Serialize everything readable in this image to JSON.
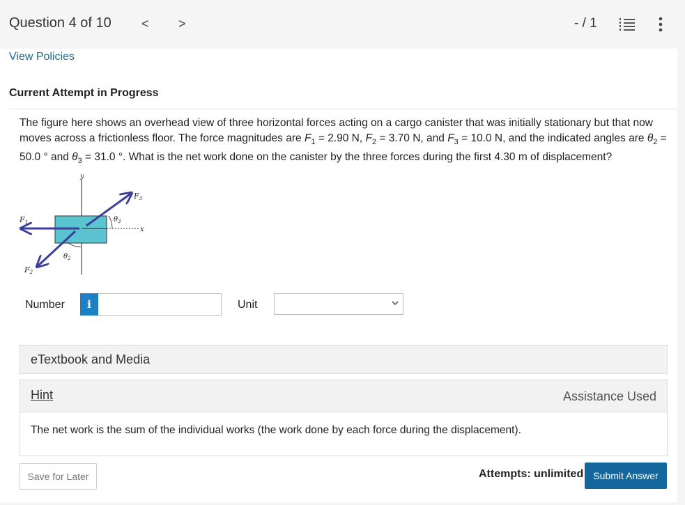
{
  "header": {
    "question_label": "Question 4 of 10",
    "prev_glyph": "<",
    "next_glyph": ">",
    "score": "- / 1",
    "list_icon": "question-list-icon",
    "more_icon": "more-options-icon"
  },
  "links": {
    "view_policies": "View Policies"
  },
  "attempt_heading": "Current Attempt in Progress",
  "question": {
    "t1": "The figure here shows an overhead view of three horizontal forces acting on a cargo canister that was initially stationary but that now moves across a frictionless floor. The force magnitudes are ",
    "f1_sym": "F",
    "f1_sub": "1",
    "f1_val": " = 2.90 N, ",
    "f2_sym": "F",
    "f2_sub": "2",
    "f2_val": " = 3.70 N, and ",
    "f3_sym": "F",
    "f3_sub": "3",
    "f3_val": " = 10.0 N, and the indicated angles are ",
    "th2_sym": "θ",
    "th2_sub": "2",
    "th2_val": " = 50.0 ° and ",
    "th3_sym": "θ",
    "th3_sub": "3",
    "th3_val": " = 31.0 °. What is the net work done on the canister by the three forces during the first 4.30 m of displacement?"
  },
  "figure": {
    "y_label": "y",
    "x_label": "x",
    "f1_label": "F",
    "f1_sub": "1",
    "f2_label": "F",
    "f2_sub": "2",
    "f3_label": "F",
    "f3_sub": "3",
    "th2_label": "θ",
    "th2_sub": "2",
    "th3_label": "θ",
    "th3_sub": "3",
    "colors": {
      "box": "#5bc4d1",
      "arrow": "#3b3f9a"
    }
  },
  "answer": {
    "number_label": "Number",
    "info_glyph": "i",
    "number_value": "",
    "unit_label": "Unit",
    "unit_selected": ""
  },
  "etextbook": {
    "label": "eTextbook and Media"
  },
  "hint": {
    "label": "Hint",
    "assistance": "Assistance Used",
    "text": "The net work is the sum of the individual works (the work done by each force during the displacement)."
  },
  "footer": {
    "save_label": "Save for Later",
    "attempts": "Attempts: unlimited",
    "submit_label": "Submit Answer"
  },
  "colors": {
    "link": "#1b6a8c",
    "submit_bg": "#14679d",
    "info_bg": "#1d7fc4"
  }
}
